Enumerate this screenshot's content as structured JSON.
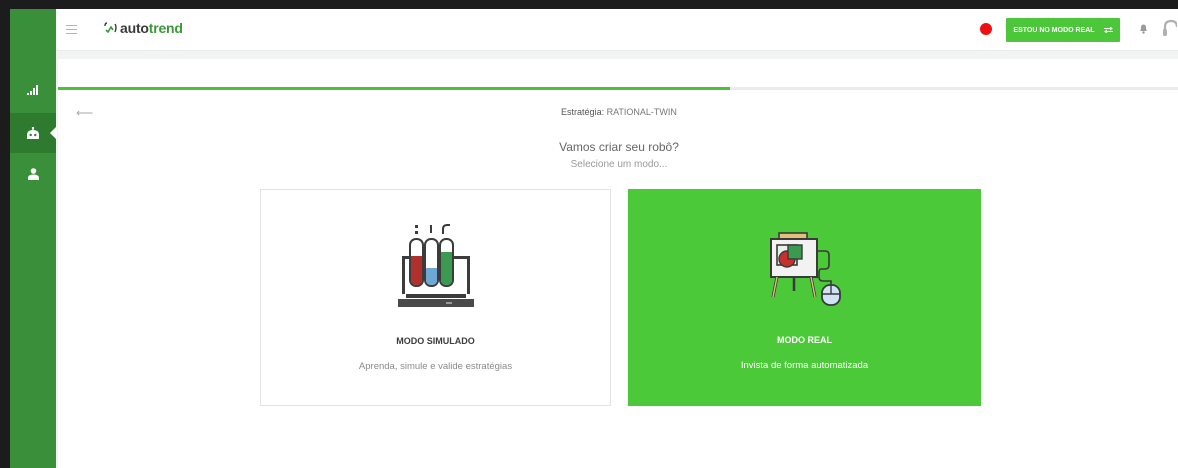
{
  "app": {
    "logo_text_primary": "auto",
    "logo_text_secondary": "trend"
  },
  "topbar": {
    "menu_icon": "hamburger-icon",
    "mode_button_label": "ESTOU NO MODO REAL",
    "mode_button_icon": "swap-arrows-icon",
    "status_color": "#ee1111",
    "notification_icon": "bell-icon",
    "support_icon": "headset-icon"
  },
  "sidebar": {
    "items": [
      {
        "name": "dashboard",
        "icon": "signal-bars-icon",
        "active": false
      },
      {
        "name": "robots",
        "icon": "robot-icon",
        "active": true
      },
      {
        "name": "profile",
        "icon": "user-icon",
        "active": false
      }
    ]
  },
  "wizard": {
    "progress": 0.6,
    "strategy_label": "Estratégia:",
    "strategy_value": "RATIONAL-TWIN",
    "title": "Vamos criar seu robô?",
    "subtitle": "Selecione um modo...",
    "options": [
      {
        "title": "MODO SIMULADO",
        "description": "Aprenda, simule e valide estratégias",
        "icon": "test-tubes-icon",
        "selected": false
      },
      {
        "title": "MODO REAL",
        "description": "Invista de forma automatizada",
        "icon": "presentation-easel-icon",
        "selected": true
      }
    ]
  },
  "colors": {
    "accent": "#4cc939",
    "sidebar": "#3a8f3a",
    "sidebar_active": "#2e7a2e"
  }
}
